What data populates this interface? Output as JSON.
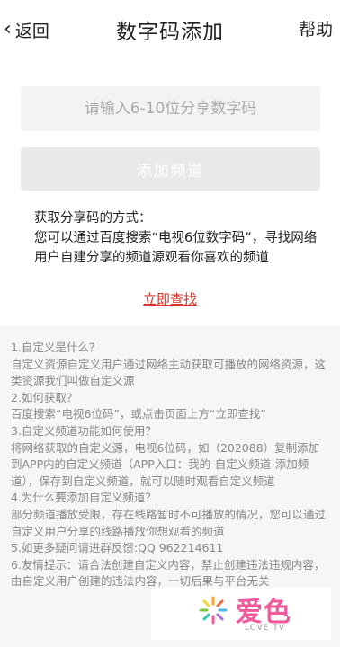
{
  "header": {
    "back_label": "返回",
    "title": "数字码添加",
    "help_label": "帮助"
  },
  "form": {
    "code_placeholder": "请输入6-10位分享数字码",
    "code_value": "",
    "add_button_label": "添加频道"
  },
  "howto": {
    "heading": "获取分享码的方式：",
    "body": "您可以通过百度搜索“电视6位数字码”，寻找网络用户自建分享的频道源观看你喜欢的频道",
    "find_link": "立即查找"
  },
  "faq": {
    "lines": [
      "1.自定义是什么？",
      "自定义资源自定义用户通过网络主动获取可播放的网络资源，这类资源我们叫做自定义源",
      "2.如何获取？",
      "百度搜索“电视6位码”，或点击页面上方“立即查找”",
      "3.自定义频道功能如何使用？",
      "将网络获取的自定义源，电视6位码，如（202088）复制添加到APP内的自定义频道（APP入口：我的-自定义频道-添加频道），保存到自定义频道，就可以随时观看自定义频道",
      "4.为什么要添加自定义频道？",
      "部分频道播放受限，存在线路暂时不可播放的情况，您可以通过自定义用户分享的线路播放你想观看的频道",
      "5.如更多疑问请进群反馈:QQ 962214611",
      "6.友情提示：请合法创建自定义内容，禁止创建违法违规内容，由自定义用户创建的违法内容，一切后果与平台无关"
    ]
  },
  "watermark": {
    "brand": "爱色",
    "sub": "LOVE TV",
    "flower_icon": "flower-logo-icon",
    "brand_color": "#f05a9c"
  },
  "colors": {
    "link": "#d9342b",
    "faq_background": "#f6f6f6",
    "input_background": "#f3f3f3",
    "button_disabled": "#e9e9e9"
  }
}
